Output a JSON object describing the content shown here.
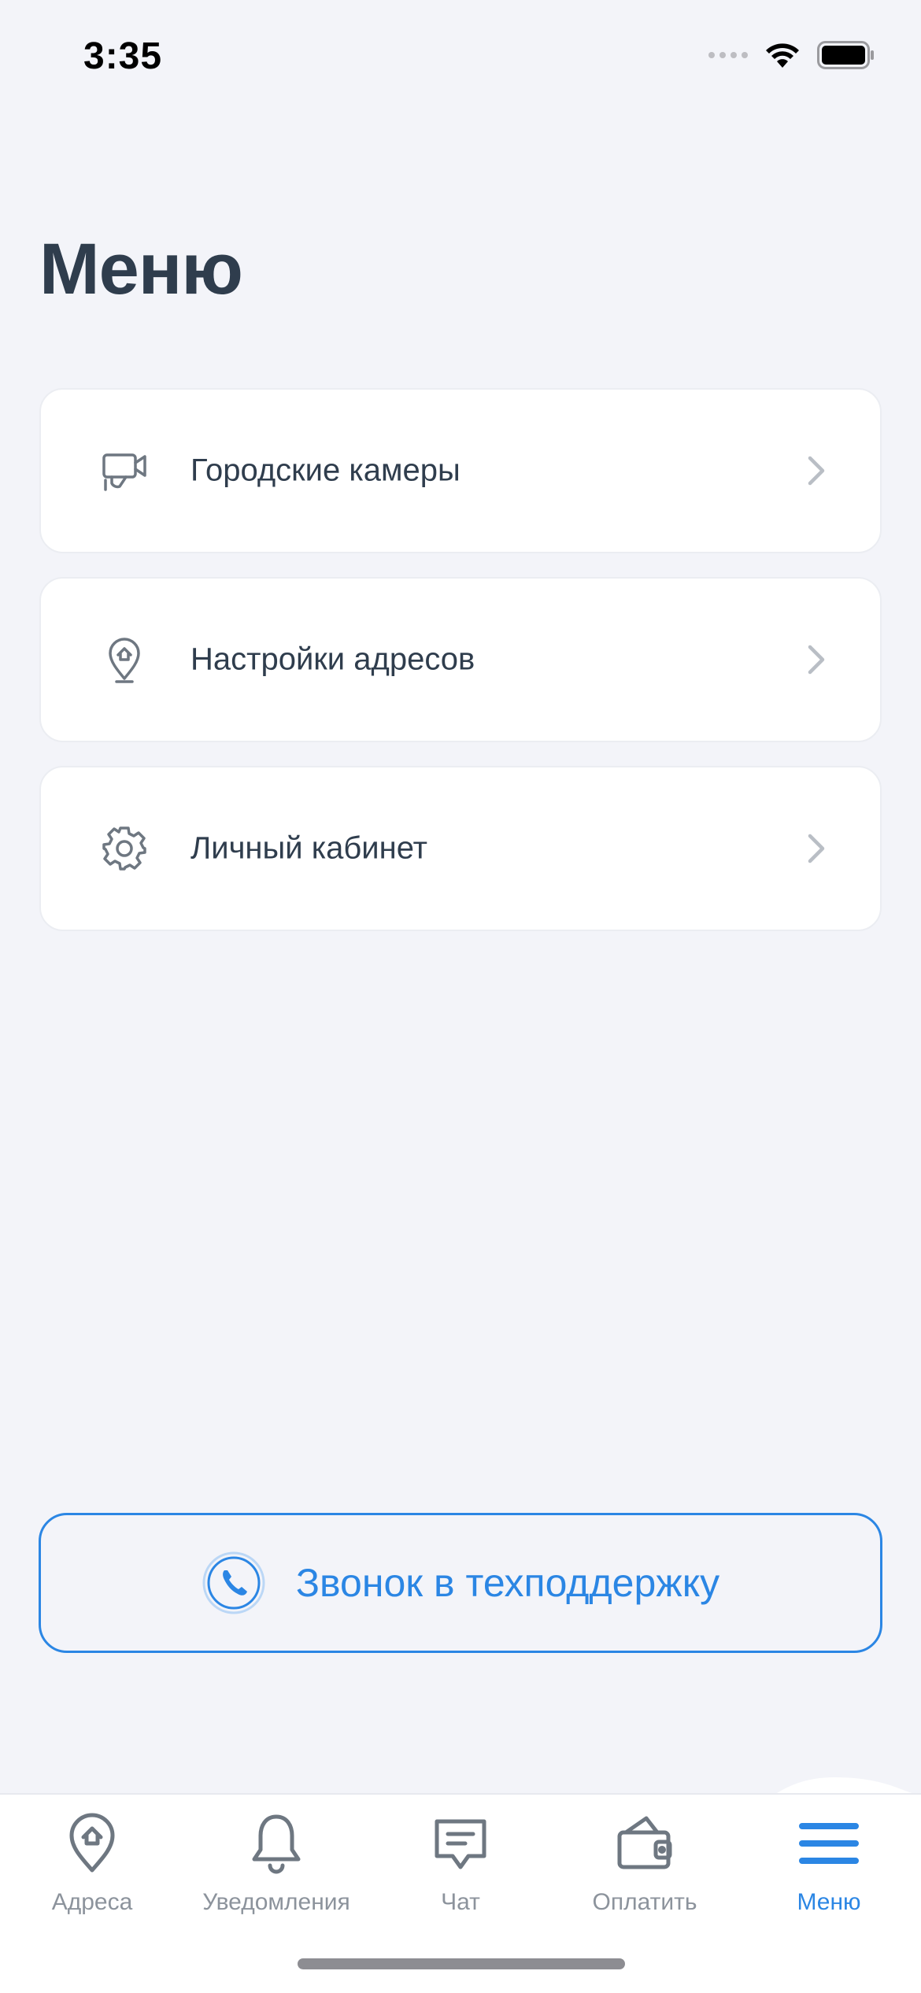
{
  "status_bar": {
    "time": "3:35"
  },
  "page": {
    "title": "Меню"
  },
  "menu_items": [
    {
      "label": "Городские камеры",
      "icon": "camera-icon"
    },
    {
      "label": "Настройки адресов",
      "icon": "location-home-icon"
    },
    {
      "label": "Личный кабинет",
      "icon": "gear-icon"
    }
  ],
  "support": {
    "label": "Звонок в техподдержку",
    "icon": "phone-icon"
  },
  "tabs": [
    {
      "label": "Адреса",
      "icon": "location-home-icon",
      "active": false
    },
    {
      "label": "Уведомления",
      "icon": "bell-icon",
      "active": false
    },
    {
      "label": "Чат",
      "icon": "chat-icon",
      "active": false
    },
    {
      "label": "Оплатить",
      "icon": "wallet-icon",
      "active": false
    },
    {
      "label": "Меню",
      "icon": "menu-icon",
      "active": true
    }
  ],
  "colors": {
    "accent": "#2B86E4",
    "text": "#2F3D4D",
    "background": "#F3F4F9",
    "inactive": "#8C939C"
  }
}
